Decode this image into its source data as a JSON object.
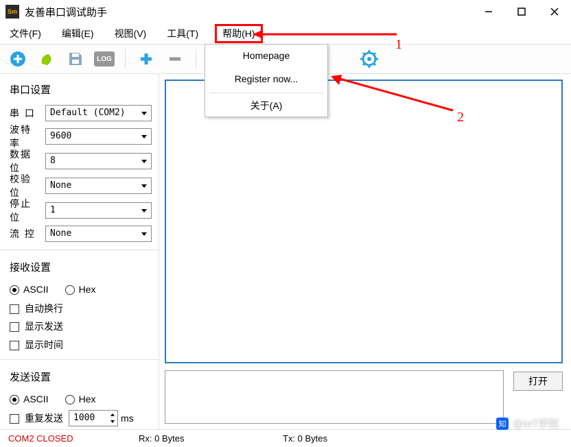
{
  "window": {
    "icon_text": "Sm",
    "title": "友善串口调试助手"
  },
  "menu": {
    "file": "文件(F)",
    "edit": "编辑(E)",
    "view": "视图(V)",
    "tools": "工具(T)",
    "help": "帮助(H)"
  },
  "help_menu": {
    "homepage": "Homepage",
    "register": "Register now...",
    "about": "关于(A)"
  },
  "annotations": {
    "one": "1",
    "two": "2"
  },
  "serial_settings": {
    "title": "串口设置",
    "port_label": "串 口",
    "port_value": "Default (COM2)",
    "baud_label": "波特率",
    "baud_value": "9600",
    "data_label": "数据位",
    "data_value": "8",
    "parity_label": "校验位",
    "parity_value": "None",
    "stop_label": "停止位",
    "stop_value": "1",
    "flow_label": "流 控",
    "flow_value": "None"
  },
  "recv_settings": {
    "title": "接收设置",
    "ascii": "ASCII",
    "hex": "Hex",
    "auto_wrap": "自动换行",
    "show_send": "显示发送",
    "show_time": "显示时间"
  },
  "send_settings": {
    "title": "发送设置",
    "ascii": "ASCII",
    "hex": "Hex",
    "repeat_label": "重复发送",
    "repeat_value": "1000",
    "ms": "ms"
  },
  "buttons": {
    "open": "打开"
  },
  "status": {
    "port": "COM2 CLOSED",
    "rx": "Rx: 0 Bytes",
    "tx": "Tx: 0 Bytes"
  },
  "watermark": "@IoT学院"
}
